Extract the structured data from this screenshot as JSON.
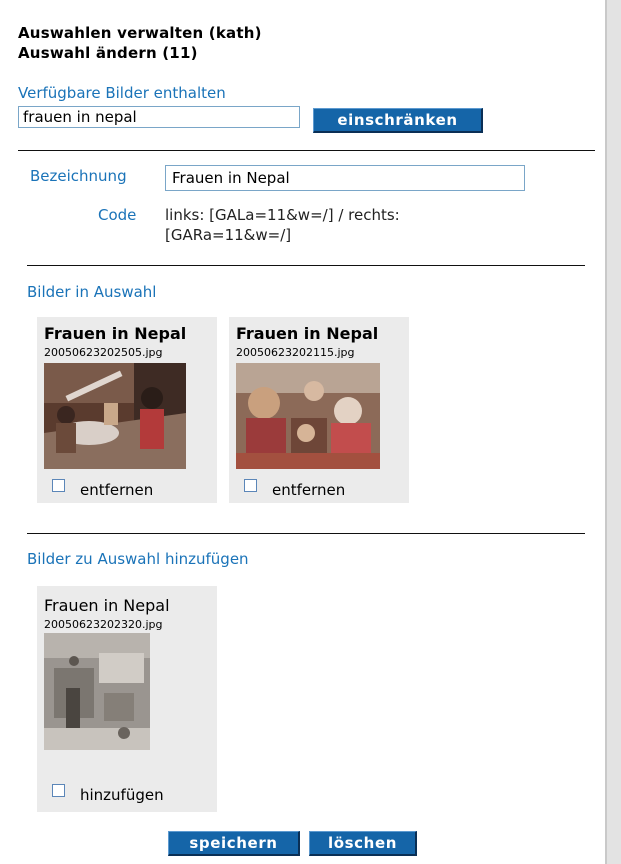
{
  "header": {
    "title": "Auswahlen verwalten (kath)",
    "subtitle": "Auswahl ändern (11)"
  },
  "filter": {
    "label": "Verfügbare Bilder enthalten",
    "value": "frauen in nepal",
    "button": "einschränken"
  },
  "form": {
    "name_label": "Bezeichnung",
    "name_value": "Frauen in Nepal",
    "code_label": "Code",
    "code_line1": "links: [GALa=11&w=/] / rechts:",
    "code_line2": "[GARa=11&w=/]"
  },
  "in_selection": {
    "heading": "Bilder in Auswahl",
    "items": [
      {
        "title": "Frauen in Nepal",
        "file": "20050623202505.jpg",
        "action": "entfernen",
        "checked": false
      },
      {
        "title": "Frauen in Nepal",
        "file": "20050623202115.jpg",
        "action": "entfernen",
        "checked": false
      }
    ]
  },
  "to_add": {
    "heading": "Bilder zu Auswahl hinzufügen",
    "items": [
      {
        "title": "Frauen in Nepal",
        "file": "20050623202320.jpg",
        "action": "hinzufügen",
        "checked": false
      }
    ]
  },
  "footer": {
    "save": "speichern",
    "delete": "löschen"
  },
  "colors": {
    "link_blue": "#1a73b8",
    "button_blue": "#1565a8",
    "card_bg": "#ebebeb"
  }
}
